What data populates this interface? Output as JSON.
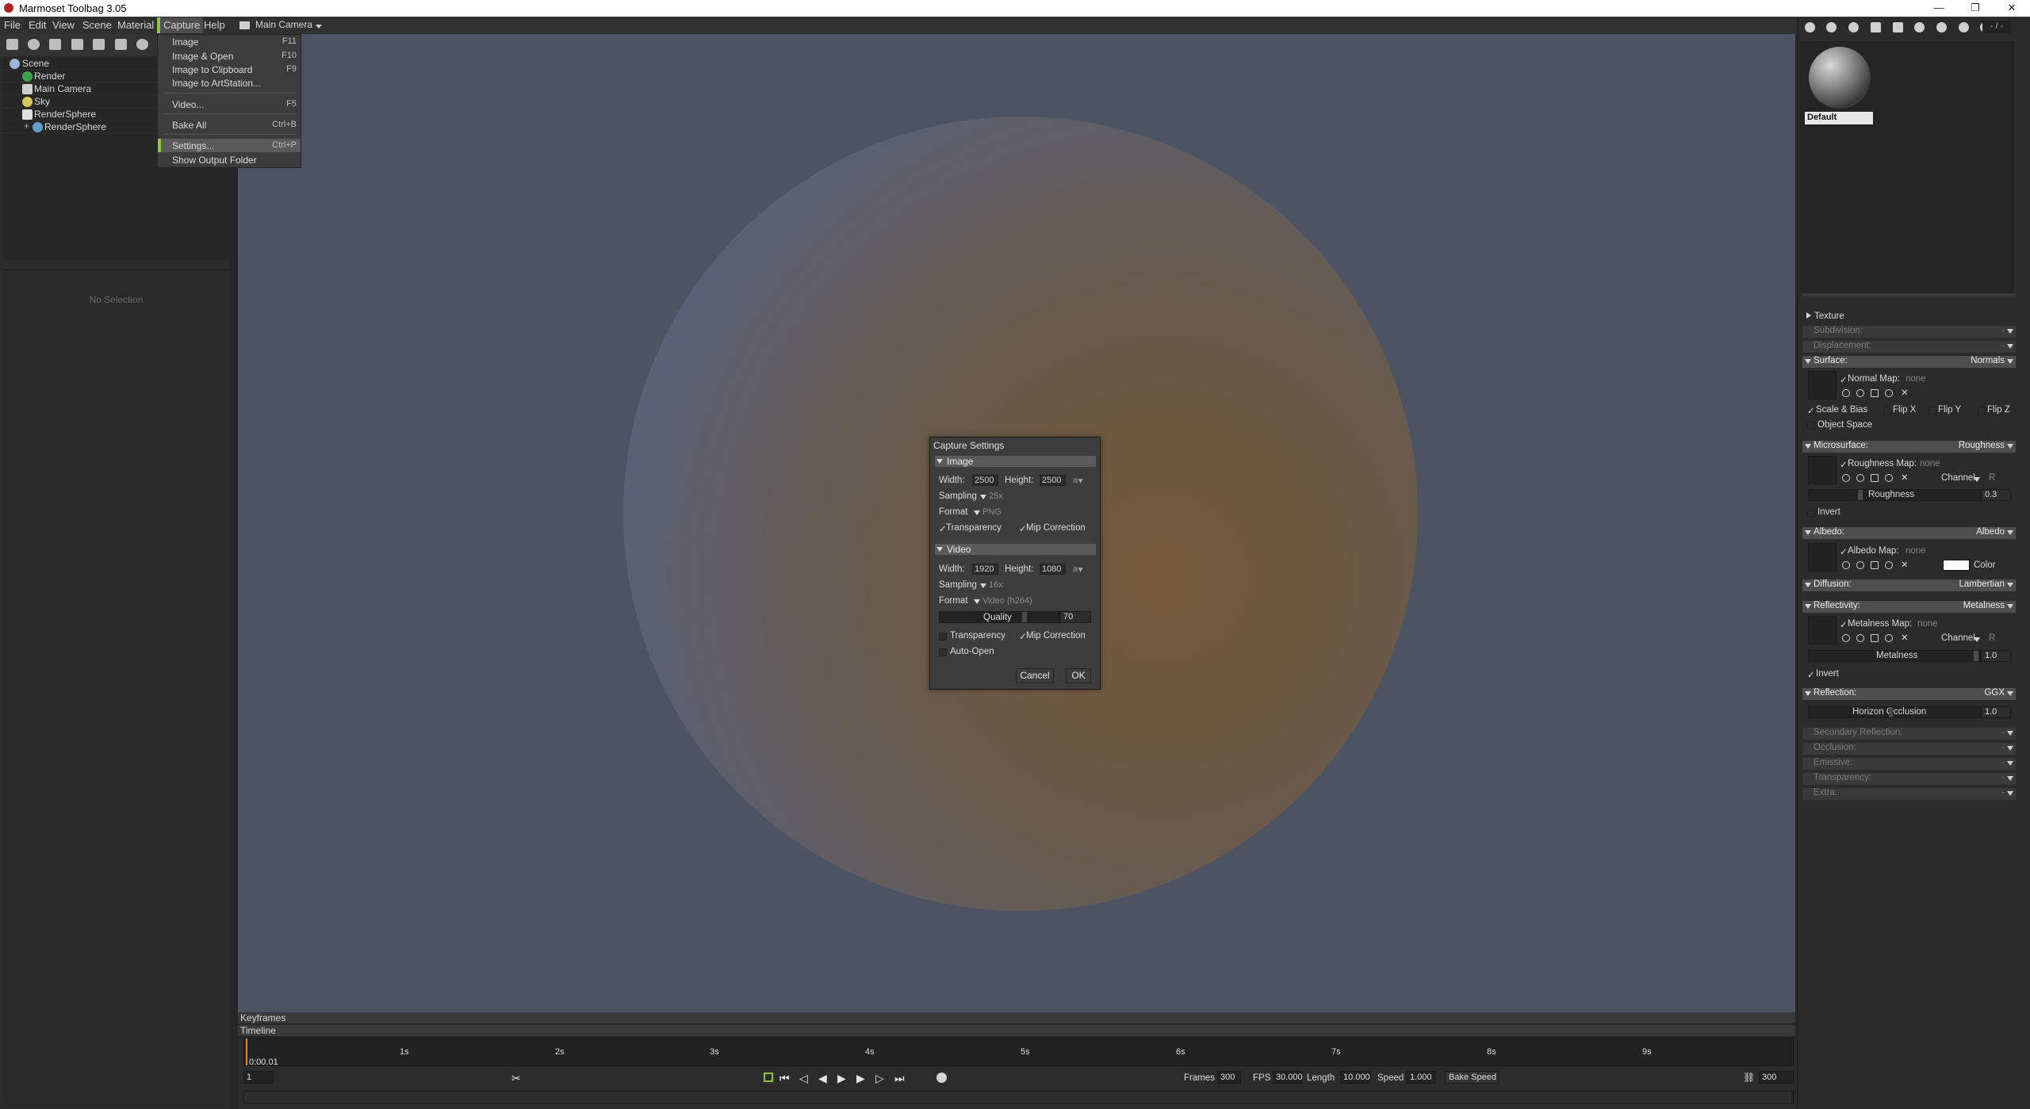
{
  "window": {
    "title": "Marmoset Toolbag 3.05",
    "controls": [
      "—",
      "❐",
      "✕"
    ]
  },
  "menubar": {
    "items": [
      "File",
      "Edit",
      "View",
      "Scene",
      "Material",
      "Capture",
      "Help"
    ],
    "camera": "Main Camera"
  },
  "capture_menu": {
    "items": [
      {
        "label": "Image",
        "shortcut": "F11"
      },
      {
        "label": "Image & Open",
        "shortcut": "F10"
      },
      {
        "label": "Image to Clipboard",
        "shortcut": "F9"
      },
      {
        "label": "Image to ArtStation...",
        "shortcut": ""
      },
      {
        "label": "Video...",
        "shortcut": "F5"
      },
      {
        "label": "Bake All",
        "shortcut": "Ctrl+B"
      },
      {
        "label": "Settings...",
        "shortcut": "Ctrl+P"
      },
      {
        "label": "Show Output Folder",
        "shortcut": ""
      }
    ]
  },
  "outliner": {
    "items": [
      "Scene",
      "Render",
      "Main Camera",
      "Sky",
      "RenderSphere",
      "RenderSphere"
    ]
  },
  "properties": {
    "empty_text": "No Selection"
  },
  "capture_dialog": {
    "title": "Capture Settings",
    "image": {
      "header": "Image",
      "width_label": "Width:",
      "width": "2500",
      "height_label": "Height:",
      "height": "2500",
      "sampling_label": "Sampling",
      "sampling": "25x",
      "format_label": "Format",
      "format": "PNG",
      "transparency": "Transparency",
      "mip": "Mip Correction"
    },
    "video": {
      "header": "Video",
      "width_label": "Width:",
      "width": "1920",
      "height_label": "Height:",
      "height": "1080",
      "sampling_label": "Sampling",
      "sampling": "16x",
      "format_label": "Format",
      "format": "Video (h264)",
      "quality_label": "Quality",
      "quality": "70",
      "transparency": "Transparency",
      "mip": "Mip Correction",
      "auto_open": "Auto-Open"
    },
    "cancel": "Cancel",
    "ok": "OK"
  },
  "material": {
    "name": "Default",
    "header_right": "- / -",
    "sections": {
      "texture": "Texture",
      "subdivision": "Subdivision:",
      "displacement": "Displacement:",
      "surface": "Surface:",
      "surface_mode": "Normals",
      "normal_map": "Normal Map:",
      "none": "none",
      "scale_bias": "Scale & Bias",
      "flip_x": "Flip X",
      "flip_y": "Flip Y",
      "flip_z": "Flip Z",
      "object_space": "Object Space",
      "microsurface": "Microsurface:",
      "micro_mode": "Roughness",
      "roughness_map": "Roughness Map:",
      "channel": "Channel",
      "channel_r": "R",
      "roughness": "Roughness",
      "roughness_val": "0.3",
      "invert": "Invert",
      "albedo": "Albedo:",
      "albedo_mode": "Albedo",
      "albedo_map": "Albedo Map:",
      "color": "Color",
      "diffusion": "Diffusion:",
      "diffusion_mode": "Lambertian",
      "reflectivity": "Reflectivity:",
      "reflect_mode": "Metalness",
      "metal_map": "Metalness Map:",
      "metalness": "Metalness",
      "metalness_val": "1.0",
      "reflection": "Reflection:",
      "reflection_mode": "GGX",
      "horizon": "Horizon Occlusion",
      "horizon_val": "1.0",
      "secondary": "Secondary Reflection:",
      "occlusion": "Occlusion:",
      "emissive": "Emissive:",
      "transparency": "Transparency:",
      "extra": "Extra:",
      "dash": "-"
    }
  },
  "timeline": {
    "keyframes": "Keyframes",
    "timeline": "Timeline",
    "current_time": "0:00.01",
    "frame": "1",
    "ticks": [
      "1s",
      "2s",
      "3s",
      "4s",
      "5s",
      "6s",
      "7s",
      "8s",
      "9s"
    ],
    "frames_label": "Frames",
    "frames": "300",
    "fps_label": "FPS",
    "fps": "30.000",
    "length_label": "Length",
    "length": "10.000",
    "speed_label": "Speed",
    "speed": "1.000",
    "bake_speed": "Bake Speed",
    "end_frame": "300"
  }
}
